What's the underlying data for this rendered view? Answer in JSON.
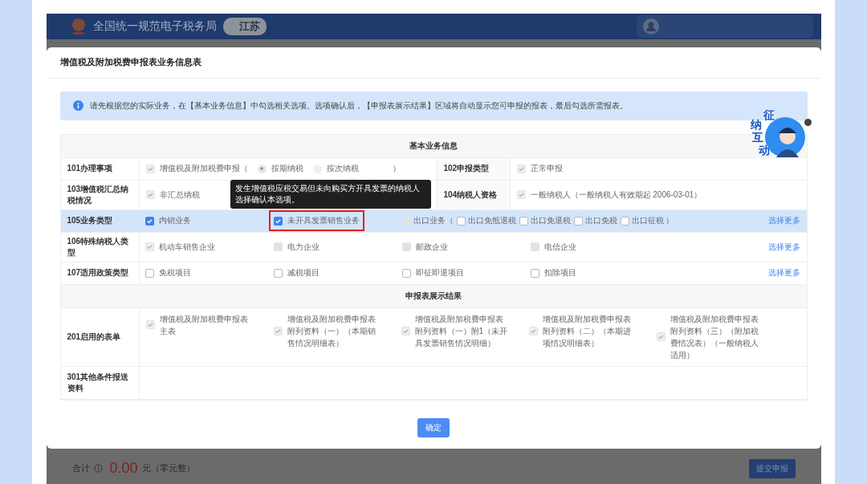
{
  "header": {
    "site_name": "全国统一规范电子税务局",
    "region": "江苏"
  },
  "modal": {
    "title": "增值税及附加税费申报表业务信息表",
    "notice": "请先根据您的实际业务，在【基本业务信息】中勾选相关选项。选项确认后，【申报表展示结果】区域将自动显示您可申报的报表，最后勾选所需报表。",
    "mascot": {
      "chars": [
        "征",
        "纳",
        "互",
        "动"
      ]
    },
    "tooltip": "发生增值税应税交易但未向购买方开具发票的纳税人选择确认本选项。",
    "sections": [
      {
        "title": "基本业务信息",
        "rows": [
          {
            "kind": "pair",
            "highlighted": false,
            "items": [
              {
                "label": "101办理事项",
                "options": [
                  {
                    "kind": "checkbox",
                    "label": "增值税及附加税费申报（",
                    "checked": true,
                    "disabled": true
                  },
                  {
                    "kind": "radio",
                    "label": "按期纳税",
                    "selected": true,
                    "disabled": true
                  },
                  {
                    "kind": "radio",
                    "label": "按次纳税",
                    "selected": false,
                    "disabled": true
                  },
                  {
                    "kind": "text",
                    "label": "）"
                  }
                ]
              },
              {
                "label": "102申报类型",
                "options": [
                  {
                    "kind": "checkbox",
                    "label": "正常申报",
                    "checked": true,
                    "disabled": true
                  }
                ]
              }
            ]
          },
          {
            "kind": "pair",
            "highlighted": false,
            "items": [
              {
                "label": "103增值税汇总纳税情况",
                "options": [
                  {
                    "kind": "checkbox",
                    "label": "非汇总纳税",
                    "checked": true,
                    "disabled": true
                  }
                ]
              },
              {
                "label": "104纳税人资格",
                "options": [
                  {
                    "kind": "checkbox",
                    "label": "一般纳税人（一般纳税人有效期起 2006-03-01）",
                    "checked": true,
                    "disabled": true
                  }
                ]
              }
            ]
          },
          {
            "kind": "grid",
            "highlighted": true,
            "label": "105业务类型",
            "link": "选择更多",
            "cells": [
              [
                {
                  "kind": "checkbox",
                  "label": "内销业务",
                  "checked": true,
                  "disabled": false,
                  "outlined": false
                }
              ],
              [
                {
                  "kind": "checkbox",
                  "label": "未开具发票销售业务",
                  "checked": true,
                  "disabled": false,
                  "outlined": true,
                  "tooltip": true
                }
              ],
              [
                {
                  "kind": "checkbox",
                  "label": "出口业务（",
                  "checked": false,
                  "disabled": true,
                  "outlined": false
                },
                {
                  "kind": "checkbox",
                  "label": "出口免抵退税",
                  "checked": false,
                  "disabled": false,
                  "outlined": false
                },
                {
                  "kind": "checkbox",
                  "label": "出口免退税",
                  "checked": false,
                  "disabled": false,
                  "outlined": false
                },
                {
                  "kind": "checkbox",
                  "label": "出口免税",
                  "checked": false,
                  "disabled": false,
                  "outlined": false
                },
                {
                  "kind": "checkbox",
                  "label": "出口征税 ）",
                  "checked": false,
                  "disabled": false,
                  "outlined": false
                }
              ]
            ]
          },
          {
            "kind": "grid",
            "highlighted": false,
            "label": "106特殊纳税人类型",
            "link": "选择更多",
            "cells": [
              [
                {
                  "kind": "checkbox",
                  "label": "机动车销售企业",
                  "checked": true,
                  "disabled": true,
                  "outlined": false
                }
              ],
              [
                {
                  "kind": "checkbox",
                  "label": "电力企业",
                  "checked": false,
                  "disabled": true,
                  "outlined": false
                }
              ],
              [
                {
                  "kind": "checkbox",
                  "label": "邮政企业",
                  "checked": false,
                  "disabled": true,
                  "outlined": false
                }
              ],
              [
                {
                  "kind": "checkbox",
                  "label": "电信企业",
                  "checked": false,
                  "disabled": true,
                  "outlined": false
                }
              ]
            ]
          },
          {
            "kind": "grid",
            "highlighted": false,
            "label": "107适用政策类型",
            "link": "选择更多",
            "cells": [
              [
                {
                  "kind": "checkbox",
                  "label": "免税项目",
                  "checked": false,
                  "disabled": false,
                  "outlined": false
                }
              ],
              [
                {
                  "kind": "checkbox",
                  "label": "减税项目",
                  "checked": false,
                  "disabled": false,
                  "outlined": false
                }
              ],
              [
                {
                  "kind": "checkbox",
                  "label": "即征即退项目",
                  "checked": false,
                  "disabled": false,
                  "outlined": false
                }
              ],
              [
                {
                  "kind": "checkbox",
                  "label": "扣除项目",
                  "checked": false,
                  "disabled": false,
                  "outlined": false
                }
              ]
            ]
          }
        ]
      },
      {
        "title": "申报表展示结果",
        "rows": [
          {
            "kind": "forms",
            "highlighted": false,
            "label": "201启用的表单",
            "cells": [
              [
                {
                  "kind": "checkbox",
                  "label": "增值税及附加税费申报表主表",
                  "checked": true,
                  "disabled": true,
                  "outlined": false
                }
              ],
              [
                {
                  "kind": "checkbox",
                  "label": "增值税及附加税费申报表附列资料（一）（本期销售情况明细表）",
                  "checked": true,
                  "disabled": true,
                  "outlined": false
                }
              ],
              [
                {
                  "kind": "checkbox",
                  "label": "增值税及附加税费申报表附列资料（一）附1（未开具发票销售情况明细）",
                  "checked": true,
                  "disabled": true,
                  "outlined": false
                }
              ],
              [
                {
                  "kind": "checkbox",
                  "label": "增值税及附加税费申报表附列资料（二）（本期进项情况明细表）",
                  "checked": true,
                  "disabled": true,
                  "outlined": false
                }
              ],
              [
                {
                  "kind": "checkbox",
                  "label": "增值税及附加税费申报表附列资料（三）（附加税费情况表）（一般纳税人适用）",
                  "checked": true,
                  "disabled": true,
                  "outlined": false
                }
              ]
            ]
          },
          {
            "kind": "forms",
            "highlighted": false,
            "label": "301其他条件报送资料",
            "cells": []
          }
        ]
      }
    ],
    "confirm": "确定"
  },
  "footer": {
    "total_label": "合计",
    "amount": "0.00",
    "unit": "元（零元整）",
    "submit": "提交申报"
  }
}
